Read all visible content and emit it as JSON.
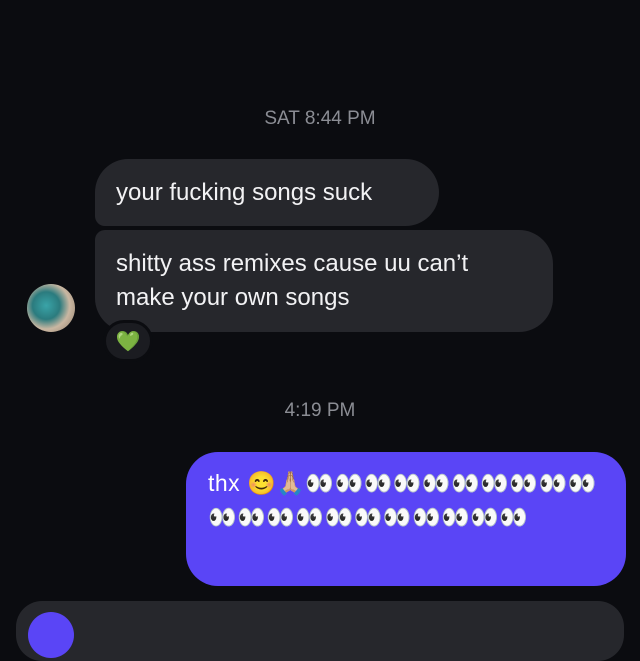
{
  "thread": {
    "timestamp_1": "SAT 8:44 PM",
    "timestamp_2": "4:19 PM",
    "incoming": [
      {
        "text": "your fucking songs suck"
      },
      {
        "text": "shitty ass remixes cause uu can’t make your own songs"
      }
    ],
    "reaction": "💚",
    "outgoing": {
      "text": "thx 😊🙏🏼👀👀👀👀👀👀👀👀👀👀👀👀👀👀👀👀👀👀👀👀👀"
    }
  },
  "colors": {
    "background": "#0b0c10",
    "incoming_bubble": "#26272c",
    "outgoing_bubble": "#5a45f6",
    "timestamp": "#8b8d94"
  },
  "icons": {
    "avatar": "avatar-image",
    "composer_action": "camera-icon"
  }
}
